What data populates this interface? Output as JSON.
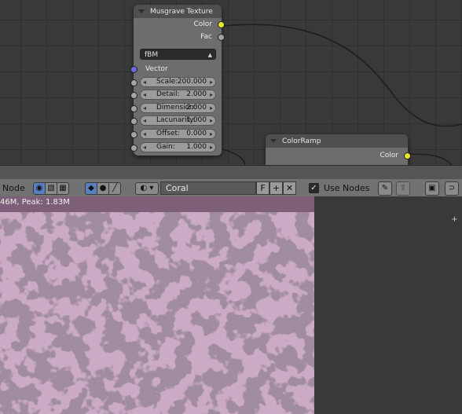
{
  "musgrave_node": {
    "title": "Musgrave Texture",
    "outputs": [
      "Color",
      "Fac"
    ],
    "type_dropdown": "fBM",
    "vector_label": "Vector",
    "fields": [
      {
        "label": "Scale:",
        "value": "200.000"
      },
      {
        "label": "Detail:",
        "value": "2.000"
      },
      {
        "label": "Dimension:",
        "value": "2.000"
      },
      {
        "label": "Lacunarity:",
        "value": "1.000"
      },
      {
        "label": "Offset:",
        "value": "0.000"
      },
      {
        "label": "Gain:",
        "value": "1.000"
      }
    ]
  },
  "colorramp_node": {
    "title": "ColorRamp",
    "outputs": [
      "Color"
    ]
  },
  "toolbar": {
    "node_label": "Node",
    "texture_name": "Coral",
    "fake_user_label": "F",
    "add_label": "+",
    "remove_label": "✕",
    "use_nodes_checked": "✓",
    "use_nodes_label": "Use Nodes"
  },
  "preview": {
    "stats_text": "46M, Peak: 1.83M",
    "corner_label": "+"
  },
  "colors": {
    "socket_color": "#e8e82e",
    "socket_value": "#a3a3a3",
    "socket_vector": "#6a6ae0",
    "active_button": "#5680c2",
    "texture_tint": "#c8a6c2"
  },
  "icons": [
    "texture-type-node-icon",
    "texture-type-world-icon",
    "texture-type-checker-icon",
    "texture-context-object-icon",
    "texture-context-sphere-icon",
    "texture-context-brush-icon",
    "texture-datablock-icon",
    "add-icon",
    "remove-icon",
    "pin-icon",
    "parent-icon",
    "render-preview-icon",
    "snap-icon"
  ]
}
